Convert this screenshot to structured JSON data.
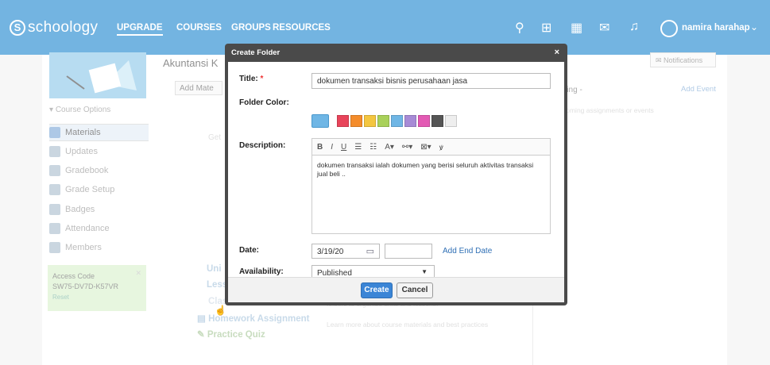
{
  "header": {
    "logo_text": "schoology",
    "logo_mark": "S",
    "nav": [
      "UPGRADE",
      "COURSES",
      "GROUPS",
      "RESOURCES"
    ],
    "user_name": "namira harahap",
    "colors": {
      "bar": "#0077c8"
    }
  },
  "sidebar": {
    "course_options": "Course Options",
    "items": [
      {
        "label": "Materials",
        "icon": "materials-icon"
      },
      {
        "label": "Updates",
        "icon": "updates-icon"
      },
      {
        "label": "Gradebook",
        "icon": "gradebook-icon"
      },
      {
        "label": "Grade Setup",
        "icon": "grade-setup-icon"
      },
      {
        "label": "Badges",
        "icon": "badges-icon"
      },
      {
        "label": "Attendance",
        "icon": "attendance-icon"
      },
      {
        "label": "Members",
        "icon": "members-icon"
      }
    ],
    "access_code": {
      "title": "Access Code",
      "code": "SW75-DV7D-K57VR",
      "reset": "Reset"
    }
  },
  "main": {
    "course_title": "Akuntansi K",
    "add_materials": "Add Mate",
    "get_text": "Get",
    "items": [
      "Uni",
      "Less",
      "Class Discussion",
      "Homework Assignment",
      "Practice Quiz"
    ],
    "hint1": "folders to organize units and lessons.",
    "hint2": "Learn more about course materials and best practices"
  },
  "right": {
    "notifications": "Notifications",
    "upcoming": "ming -",
    "add_event": "Add Event",
    "no_upcoming": "coming assignments or events"
  },
  "modal": {
    "title": "Create Folder",
    "close": "×",
    "title_label": "Title:",
    "required": "*",
    "title_value": "dokumen transaksi bisnis perusahaan jasa",
    "color_label": "Folder Color:",
    "colors": [
      "#e8445a",
      "#f48c2b",
      "#f4c640",
      "#a9d15a",
      "#6fb6e5",
      "#a78bd6",
      "#e35ab4",
      "#555555",
      "#eeeeee"
    ],
    "description_label": "Description:",
    "description_value": "dokumen transaksi ialah dokumen yang berisi seluruh aktivitas transaksi jual beli ..",
    "date_label": "Date:",
    "date_value": "3/19/20",
    "add_end_date": "Add End Date",
    "availability_label": "Availability:",
    "availability_value": "Published",
    "create": "Create",
    "cancel": "Cancel"
  }
}
